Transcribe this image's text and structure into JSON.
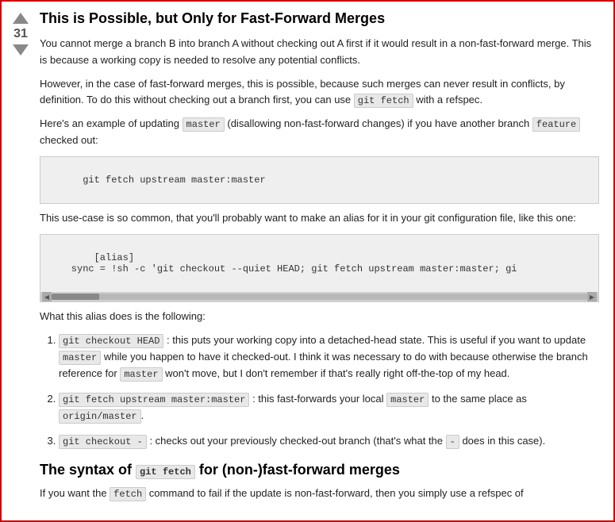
{
  "vote": {
    "count": "31"
  },
  "answer": {
    "title": "This is Possible, but Only for Fast-Forward Merges",
    "para1": "You cannot merge a branch B into branch A without checking out A first if it would result in a non-fast-forward merge. This is because a working copy is needed to resolve any potential conflicts.",
    "para2_before": "However, in the case of fast-forward merges, this is possible, because such merges can never result in conflicts, by definition. To do this without checking out a branch first, you can use ",
    "para2_code1": "git fetch",
    "para2_after": " with a refspec.",
    "para3_before": "Here's an example of updating ",
    "para3_code1": "master",
    "para3_middle": " (disallowing non-fast-forward changes) if you have another branch ",
    "para3_code2": "feature",
    "para3_after": " checked out:",
    "code_block1": "git fetch upstream master:master",
    "para4_before": "This use-case is so common, that you'll probably want to make an alias for it in your git configuration file, like this one:",
    "code_block2": "[alias]\n    sync = !sh -c 'git checkout --quiet HEAD; git fetch upstream master:master; gi",
    "para5": "What this alias does is the following:",
    "list": [
      {
        "code": "git checkout HEAD",
        "text_before": ": this puts your working copy into a detached-head state. This is useful if you want to update ",
        "code2": "master",
        "text_middle": " while you happen to have it checked-out. I think it was necessary to do with because otherwise the branch reference for ",
        "code3": "master",
        "text_after": " won't move, but I don't remember if that's really right off-the-top of my head."
      },
      {
        "code": "git fetch upstream master:master",
        "text_before": ": this fast-forwards your local ",
        "code2": "master",
        "text_middle": " to the same place as ",
        "code3": "origin/master",
        "text_after": "."
      },
      {
        "code": "git checkout -",
        "text_before": ": checks out your previously checked-out branch (that's what the ",
        "code2": "-",
        "text_middle": " does in this case).",
        "text_after": ""
      }
    ],
    "section_title_before": "The syntax of ",
    "section_title_code": "git fetch",
    "section_title_after": " for (non-)fast-forward merges",
    "para_last_before": "If you want the ",
    "para_last_code": "fetch",
    "para_last_after": " command to fail if the update is non-fast-forward, then you simply use a refspec of"
  }
}
